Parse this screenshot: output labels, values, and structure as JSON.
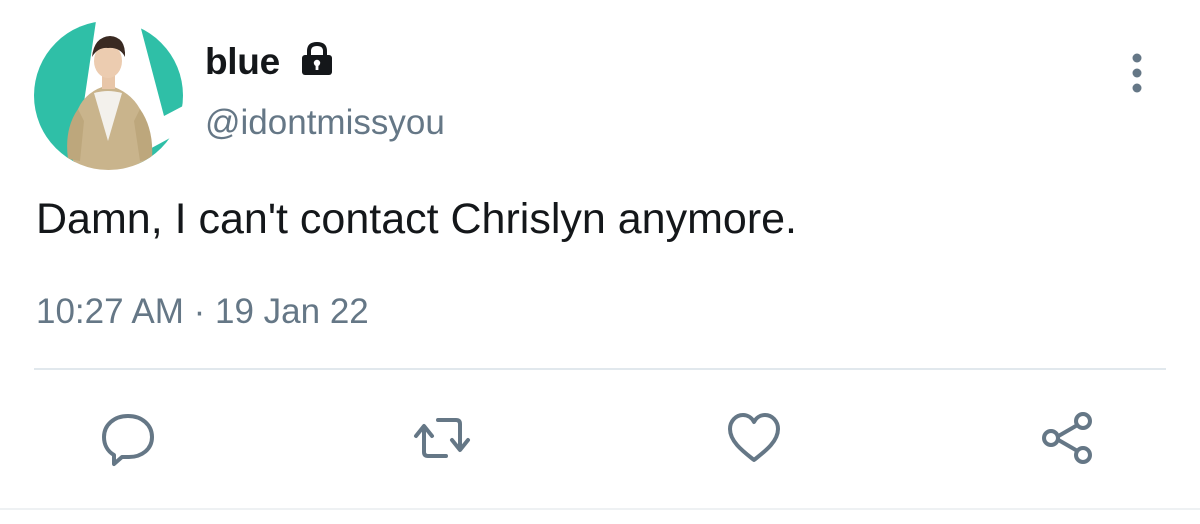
{
  "user": {
    "display_name": "blue",
    "handle": "@idontmissyou",
    "protected_icon": "lock-icon",
    "avatar_bg_color": "#2fbfa7"
  },
  "tweet": {
    "text": "Damn, I can't contact Chrislyn anymore.",
    "time": "10:27 AM",
    "separator": "·",
    "date": "19 Jan 22"
  },
  "actions": [
    {
      "name": "reply",
      "icon": "reply-icon"
    },
    {
      "name": "retweet",
      "icon": "retweet-icon"
    },
    {
      "name": "like",
      "icon": "heart-icon"
    },
    {
      "name": "share",
      "icon": "share-icon"
    }
  ],
  "menu": {
    "icon": "more-vertical-icon"
  },
  "colors": {
    "text": "#14171a",
    "secondary": "#657786",
    "divider": "#e1e8ed"
  }
}
